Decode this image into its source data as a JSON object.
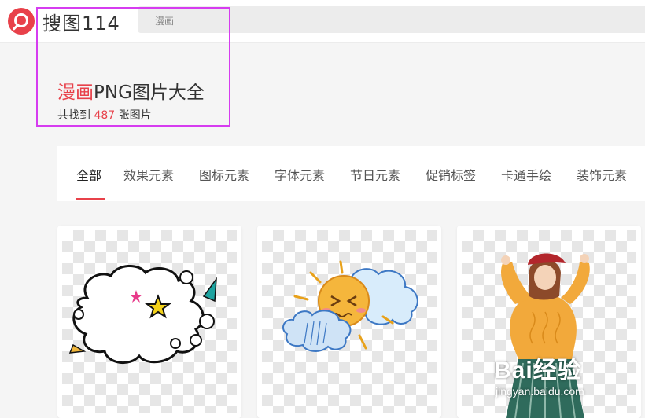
{
  "header": {
    "site_name": "搜图114",
    "search_value": "漫画"
  },
  "result": {
    "keyword": "漫画",
    "title_suffix": "PNG图片大全",
    "count_prefix": "共找到",
    "count": "487",
    "count_suffix": "张图片"
  },
  "tabs": [
    {
      "label": "全部",
      "active": true
    },
    {
      "label": "效果元素"
    },
    {
      "label": "图标元素"
    },
    {
      "label": "字体元素"
    },
    {
      "label": "节日元素"
    },
    {
      "label": "促销标签"
    },
    {
      "label": "卡通手绘"
    },
    {
      "label": "装饰元素"
    }
  ],
  "cards": [
    {
      "icon": "comic-cloud-speech-bubble-icon"
    },
    {
      "icon": "cartoon-sun-clouds-icon"
    },
    {
      "icon": "girl-beret-illustration-icon"
    }
  ],
  "watermark": {
    "logo": "Bai经验",
    "url": "jingyan.baidu.com"
  },
  "colors": {
    "accent": "#e8414a",
    "highlight_box": "#d63cf0"
  }
}
